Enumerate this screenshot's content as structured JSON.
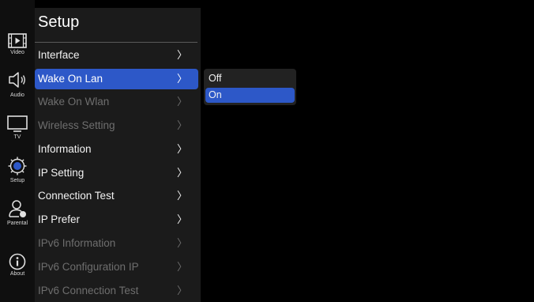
{
  "colors": {
    "background": "#000000",
    "panel": "#1b1b1b",
    "rail": "#0f0f0f",
    "accent": "#2d58c8",
    "text": "#f2f2f2",
    "disabled_text": "#6e6e6e",
    "setup_icon": "#2d58c8"
  },
  "rail": {
    "items": [
      {
        "label": "Video",
        "icon": "video-icon"
      },
      {
        "label": "Audio",
        "icon": "speaker-icon"
      },
      {
        "label": "TV",
        "icon": "tv-icon"
      },
      {
        "label": "Setup",
        "icon": "gear-icon",
        "active": true
      },
      {
        "label": "Parental",
        "icon": "parental-lock-icon"
      },
      {
        "label": "About",
        "icon": "info-icon"
      }
    ]
  },
  "panel": {
    "title": "Setup",
    "chevron": "〉",
    "items": [
      {
        "label": "Interface",
        "state": "enabled"
      },
      {
        "label": "Wake On Lan",
        "state": "selected"
      },
      {
        "label": "Wake On Wlan",
        "state": "disabled"
      },
      {
        "label": "Wireless Setting",
        "state": "disabled"
      },
      {
        "label": "Information",
        "state": "enabled"
      },
      {
        "label": "IP Setting",
        "state": "enabled"
      },
      {
        "label": "Connection Test",
        "state": "enabled"
      },
      {
        "label": "IP Prefer",
        "state": "enabled"
      },
      {
        "label": "IPv6 Information",
        "state": "disabled"
      },
      {
        "label": "IPv6 Configuration IP",
        "state": "disabled"
      },
      {
        "label": "IPv6 Connection Test",
        "state": "disabled"
      }
    ]
  },
  "submenu": {
    "options": [
      {
        "label": "Off",
        "selected": false
      },
      {
        "label": "On",
        "selected": true
      }
    ]
  }
}
